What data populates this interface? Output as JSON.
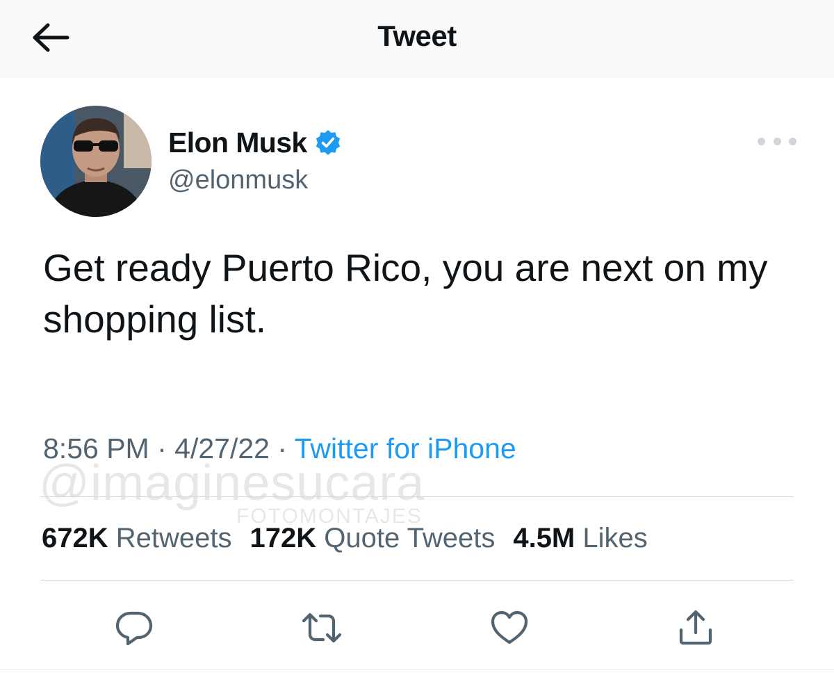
{
  "header": {
    "title": "Tweet",
    "back_icon": "arrow-left-icon"
  },
  "author": {
    "name": "Elon Musk",
    "handle": "@elonmusk",
    "verified": true,
    "verified_icon": "verified-badge-icon"
  },
  "tweet": {
    "text": "Get ready Puerto Rico, you are next on my shopping list.",
    "time": "8:56 PM",
    "date": "4/27/22",
    "source": "Twitter for iPhone",
    "separator": " · "
  },
  "stats": {
    "retweets_count": "672K",
    "retweets_label": "Retweets",
    "quotes_count": "172K",
    "quotes_label": "Quote Tweets",
    "likes_count": "4.5M",
    "likes_label": "Likes"
  },
  "watermark": {
    "main": "@imaginesucara",
    "sub": "FOTOMONTAJES"
  },
  "actions": [
    "reply-icon",
    "retweet-icon",
    "like-icon",
    "share-icon"
  ],
  "colors": {
    "accent": "#1d9bf0",
    "secondary_text": "#536471",
    "primary_text": "#0f1419",
    "divider": "#cfd9de"
  }
}
